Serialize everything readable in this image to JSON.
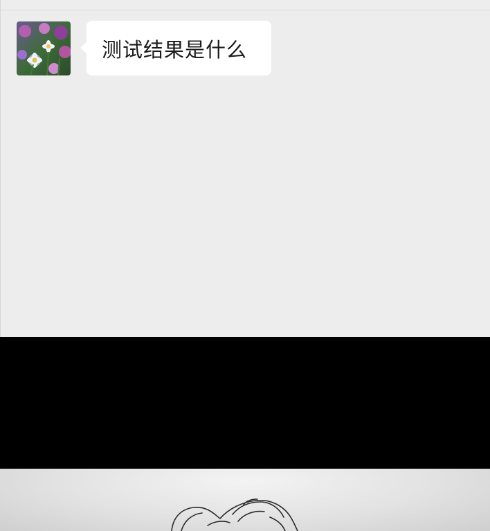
{
  "message": {
    "text": "测试结果是什么"
  },
  "colors": {
    "chat_background": "#ededed",
    "bubble": "#ffffff",
    "band": "#000000"
  },
  "icons": {
    "avatar": "flower-photo-avatar"
  }
}
